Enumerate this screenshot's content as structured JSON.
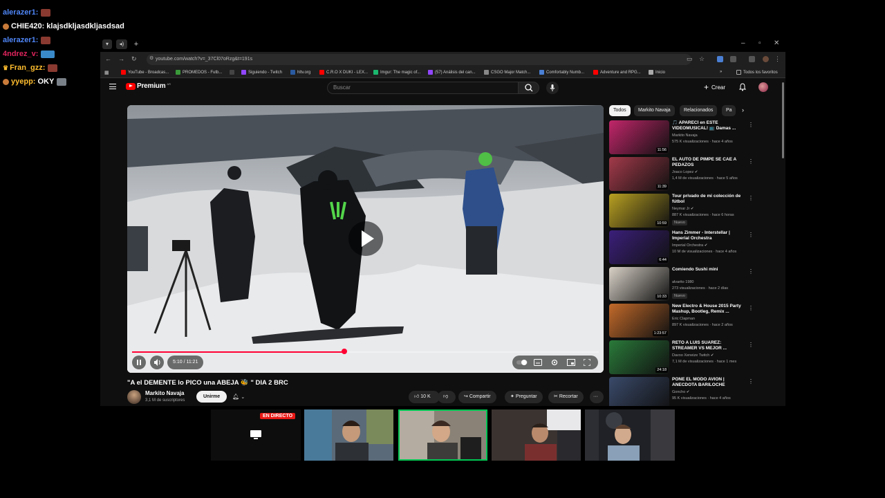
{
  "chat": {
    "messages": [
      {
        "user": "alerazer1:",
        "user_color": "#4f86f7",
        "text": ""
      },
      {
        "user": "CHIE420:",
        "user_color": "#ffffff",
        "text": "klajsdkljasdkljasdsad"
      },
      {
        "user": "alerazer1:",
        "user_color": "#4f86f7",
        "text": ""
      },
      {
        "user": "4ndrez_v:",
        "user_color": "#e0245e",
        "text": ""
      },
      {
        "user": "Fran_gzz:",
        "user_color": "#ffbd2e",
        "text": ""
      },
      {
        "user": "yyepp:",
        "user_color": "#ffbd2e",
        "text": "OKY"
      }
    ]
  },
  "browser": {
    "url": "youtube.com/watch?v=_37Cl07oRzg&t=191s",
    "bookmarks": [
      "YouTube - Broadcas...",
      "PROMEDOS - Futb...",
      "Siguiendo - Twitch",
      "hltv.org",
      "C.R.O X DUKI - LEX...",
      "Imgur: The magic of...",
      "(57) Análisis del can...",
      "CSGO Major Match...",
      "Comfortably Numb...",
      "Adventure and RPG...",
      "Inicio"
    ],
    "all_bookmarks": "Todos los favoritos"
  },
  "youtube": {
    "logo": "Premium",
    "logo_region": "AR",
    "search_placeholder": "Buscar",
    "create_label": "Crear",
    "player": {
      "current_time": "5:10",
      "duration": "11:21",
      "time_text": "5:10 / 11:21",
      "progress_fraction": 0.455
    },
    "video": {
      "title": "\"A el DEMENTE lo PICO una ABEJA 🐝 \" DIA 2 BRC",
      "channel": "Markito Navaja",
      "subscribers": "3,1 M de suscriptores",
      "subscribe_label": "Unirme",
      "likes": "10 K",
      "share_label": "Compartir",
      "ask_label": "Preguntar",
      "clip_label": "Recortar"
    },
    "chips": [
      "Todos",
      "Markito Navaja",
      "Relacionados",
      "Pa"
    ],
    "recommendations": [
      {
        "title": "🎵 APARECÍ en ESTE VIDEOMUSICAL! 📺 Damas ...",
        "channel": "Markito Navaja",
        "meta": "575 K visualizaciones · hace 4 años",
        "duration": "11:56",
        "badge": "",
        "thumb": "#c2266a"
      },
      {
        "title": "EL AUTO DE PIMPE SE CAE A PEDAZOS",
        "channel": "Joaco Lopez ✔",
        "meta": "1,4 M de visualizaciones · hace 5 años",
        "duration": "11:39",
        "badge": "",
        "thumb": "#a33a4a"
      },
      {
        "title": "Tour privado de mi colección de fútbol",
        "channel": "Neymar Jr ✔",
        "meta": "887 K visualizaciones · hace 6 horas",
        "duration": "10:59",
        "badge": "Nuevo",
        "thumb": "#b8a022"
      },
      {
        "title": "Hans Zimmer - Interstellar | Imperial Orchestra",
        "channel": "Imperial Orchestra ✔",
        "meta": "10 M de visualizaciones · hace 4 años",
        "duration": "6:44",
        "badge": "",
        "thumb": "#3b1f7a"
      },
      {
        "title": "Comiendo Sushi mini",
        "channel": "alvarito 1980",
        "meta": "273 visualizaciones · hace 2 días",
        "duration": "10:33",
        "badge": "Nuevo",
        "thumb": "#d9d2c8"
      },
      {
        "title": "New Electro & House 2015 Party Mashup, Bootleg, Remix ...",
        "channel": "Eric Clapman",
        "meta": "897 K visualizaciones · hace 2 años",
        "duration": "1:23:57",
        "badge": "",
        "thumb": "#c36a2a"
      },
      {
        "title": "RETO A LUIS SUAREZ: STREAMER VS MEJOR ...",
        "channel": "Davoo Xeneize Twitch ✔",
        "meta": "7,1 M de visualizaciones · hace 1 mes",
        "duration": "24:18",
        "badge": "",
        "thumb": "#2a7a3a"
      },
      {
        "title": "PONE EL MODO AVION | ANECDOTA BARILOCHE",
        "channel": "Goncho ✔",
        "meta": "95 K visualizaciones · hace 4 años",
        "duration": "",
        "badge": "",
        "thumb": "#3a4a6a"
      }
    ]
  },
  "stream": {
    "live_label": "EN DIRECTO"
  }
}
